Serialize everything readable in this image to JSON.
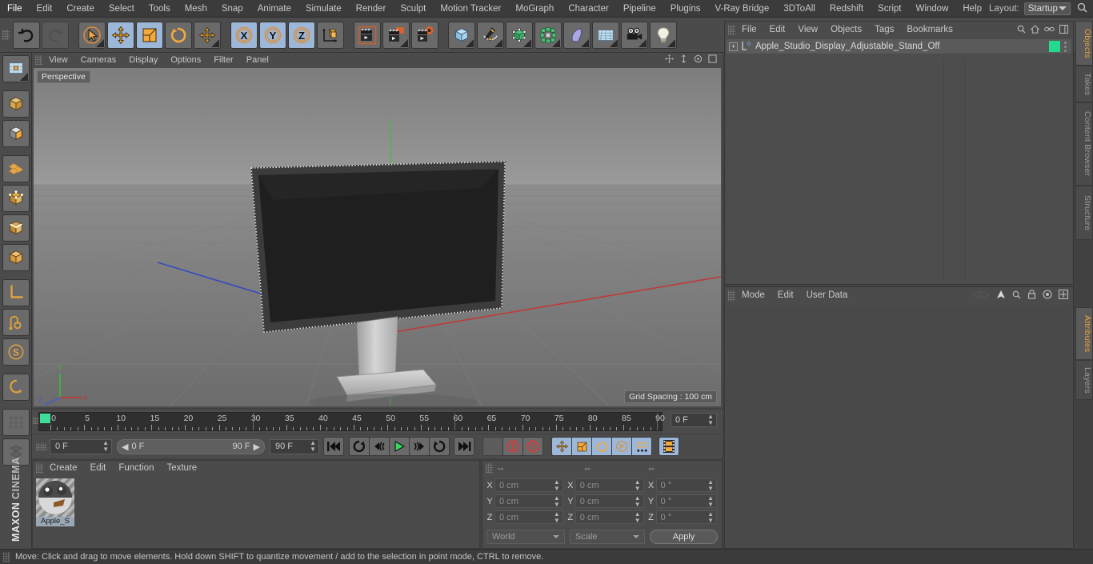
{
  "app": {
    "brand_maxon": "MAXON",
    "brand_product": "CINEMA 4D"
  },
  "menubar": {
    "items": [
      "File",
      "Edit",
      "Create",
      "Select",
      "Tools",
      "Mesh",
      "Snap",
      "Animate",
      "Simulate",
      "Render",
      "Sculpt",
      "Motion Tracker",
      "MoGraph",
      "Character",
      "Pipeline",
      "Plugins",
      "V-Ray Bridge",
      "3DToAll",
      "Redshift",
      "Script",
      "Window",
      "Help"
    ],
    "layout_label": "Layout:",
    "layout_value": "Startup",
    "search_icon": "magnifier-icon"
  },
  "toolbar": {
    "buttons": [
      {
        "name": "undo-button",
        "icon": "undo-arrow-icon",
        "state": "normal"
      },
      {
        "name": "redo-button",
        "icon": "redo-arrow-icon",
        "state": "disabled"
      },
      {
        "name": "select-tool-button",
        "icon": "cursor-circle-icon",
        "state": "normal"
      },
      {
        "name": "move-tool-button",
        "icon": "move-cross-icon",
        "state": "active"
      },
      {
        "name": "scale-tool-button",
        "icon": "scale-box-icon",
        "state": "normal"
      },
      {
        "name": "rotate-tool-button",
        "icon": "rotate-circle-icon",
        "state": "normal"
      },
      {
        "name": "axis-move-button",
        "icon": "move-cross-icon",
        "state": "normal"
      },
      {
        "name": "x-axis-button",
        "icon": "x-axis-icon",
        "state": "active"
      },
      {
        "name": "y-axis-button",
        "icon": "y-axis-icon",
        "state": "active"
      },
      {
        "name": "z-axis-button",
        "icon": "z-axis-icon",
        "state": "active"
      },
      {
        "name": "world-object-axis-button",
        "icon": "axis-cube-icon",
        "state": "normal"
      },
      {
        "name": "render-view-button",
        "icon": "clapper-icon",
        "state": "normal"
      },
      {
        "name": "render-picture-viewer-button",
        "icon": "clapper-picture-icon",
        "state": "normal"
      },
      {
        "name": "render-settings-button",
        "icon": "clapper-gear-icon",
        "state": "normal"
      },
      {
        "name": "cube-primitive-button",
        "icon": "cube-icon",
        "state": "normal"
      },
      {
        "name": "spline-pen-button",
        "icon": "pen-spline-icon",
        "state": "normal"
      },
      {
        "name": "nurbs-button",
        "icon": "subdivision-cube-icon",
        "state": "normal"
      },
      {
        "name": "array-button",
        "icon": "array-green-icon",
        "state": "normal"
      },
      {
        "name": "bend-deformer-button",
        "icon": "bend-deformer-icon",
        "state": "normal"
      },
      {
        "name": "floor-environment-button",
        "icon": "floor-grid-icon",
        "state": "normal"
      },
      {
        "name": "camera-button",
        "icon": "camera-icon",
        "state": "normal"
      },
      {
        "name": "light-button",
        "icon": "lightbulb-icon",
        "state": "normal"
      }
    ]
  },
  "leftbar": {
    "buttons": [
      {
        "name": "texture-axis-button",
        "icon": "texture-axis-icon"
      },
      {
        "name": "model-mode-button",
        "icon": "model-cube-icon"
      },
      {
        "name": "texture-mode-button",
        "icon": "texture-mode-icon"
      },
      {
        "name": "polygon-mode-button",
        "icon": "polygon-mesh-icon"
      },
      {
        "name": "point-mode-button",
        "icon": "point-mode-icon"
      },
      {
        "name": "edge-mode-button",
        "icon": "edge-mode-icon"
      },
      {
        "name": "polygon-select-button",
        "icon": "polygon-orange-icon"
      },
      {
        "name": "workplane-button",
        "icon": "workplane-icon"
      },
      {
        "name": "enable-axis-button",
        "icon": "axis-modify-icon"
      },
      {
        "name": "soft-selection-button",
        "icon": "soft-selection-icon"
      },
      {
        "name": "snap-toggle-button",
        "icon": "snap-magnet-icon"
      },
      {
        "name": "viewport-solo-button",
        "icon": "solo-icon"
      },
      {
        "name": "layout-grid-button",
        "icon": "grid-dots-icon"
      }
    ]
  },
  "viewport": {
    "menu": [
      "View",
      "Cameras",
      "Display",
      "Options",
      "Filter",
      "Panel"
    ],
    "perspective_label": "Perspective",
    "grid_spacing_label": "Grid Spacing : 100 cm",
    "icons": [
      "pan-icon",
      "zoom-icon",
      "rotate-icon",
      "maximize-icon"
    ]
  },
  "object_manager": {
    "menu": [
      "File",
      "Edit",
      "View",
      "Objects",
      "Tags",
      "Bookmarks"
    ],
    "icons": [
      "search-icon",
      "home-icon",
      "link-icon",
      "layout-icon"
    ],
    "rows": [
      {
        "name": "Apple_Studio_Display_Adjustable_Stand_Off",
        "expand": "+",
        "level_badge": "0",
        "swatch_color": "#22d98e"
      }
    ]
  },
  "attribute_manager": {
    "menu": [
      "Mode",
      "Edit",
      "User Data"
    ],
    "icons": [
      "history-icon",
      "arrow-up-icon",
      "search-icon",
      "lock-icon",
      "target-icon",
      "layout-icon"
    ]
  },
  "right_tabs": [
    {
      "label": "Objects",
      "selected": true
    },
    {
      "label": "Takes",
      "selected": false
    },
    {
      "label": "Content Browser",
      "selected": false
    },
    {
      "label": "Structure",
      "selected": false
    },
    {
      "label": "Attributes",
      "selected": true
    },
    {
      "label": "Layers",
      "selected": false
    }
  ],
  "timeline": {
    "ticks": [
      0,
      5,
      10,
      15,
      20,
      25,
      30,
      35,
      40,
      45,
      50,
      55,
      60,
      65,
      70,
      75,
      80,
      85,
      90
    ],
    "min_frame": 0,
    "max_frame": 90,
    "current_frame_field": "0 F"
  },
  "transport": {
    "current_frame": "0 F",
    "range_start": "0 F",
    "range_end": "90 F",
    "end_frame": "90 F",
    "buttons": [
      {
        "name": "go-to-start-button",
        "icon": "skip-start-icon",
        "state": "normal"
      },
      {
        "name": "loop-back-button",
        "icon": "loop-back-icon",
        "state": "normal"
      },
      {
        "name": "step-back-button",
        "icon": "step-back-icon",
        "state": "normal"
      },
      {
        "name": "play-button",
        "icon": "play-icon",
        "state": "normal"
      },
      {
        "name": "step-forward-button",
        "icon": "step-forward-icon",
        "state": "normal"
      },
      {
        "name": "loop-forward-button",
        "icon": "loop-forward-icon",
        "state": "normal"
      },
      {
        "name": "go-to-end-button",
        "icon": "skip-end-icon",
        "state": "normal"
      },
      {
        "name": "record-active-objects-button",
        "icon": "key-icon",
        "state": "disabled"
      },
      {
        "name": "autokeying-button",
        "icon": "record-circle-icon",
        "state": "red"
      },
      {
        "name": "keyframe-help-button",
        "icon": "question-circle-icon",
        "state": "red"
      },
      {
        "name": "position-key-button",
        "icon": "move-cross-icon",
        "state": "active"
      },
      {
        "name": "scale-key-button",
        "icon": "scale-box-icon",
        "state": "active"
      },
      {
        "name": "rotation-key-button",
        "icon": "rotate-circle-icon",
        "state": "active"
      },
      {
        "name": "param-key-button",
        "icon": "p-circle-icon",
        "state": "active"
      },
      {
        "name": "pla-key-button",
        "icon": "dots-grid-icon",
        "state": "active"
      },
      {
        "name": "timeline-button",
        "icon": "film-strip-icon",
        "state": "active"
      }
    ]
  },
  "material_manager": {
    "menu": [
      "Create",
      "Edit",
      "Function",
      "Texture"
    ],
    "materials": [
      {
        "name": "Apple_S"
      }
    ]
  },
  "coordinates": {
    "headers": [
      "--",
      "--",
      "--"
    ],
    "rows": [
      {
        "axis": "X",
        "position": "0 cm",
        "size": "0 cm",
        "rotation": "0 °"
      },
      {
        "axis": "Y",
        "position": "0 cm",
        "size": "0 cm",
        "rotation": "0 °"
      },
      {
        "axis": "Z",
        "position": "0 cm",
        "size": "0 cm",
        "rotation": "0 °"
      }
    ],
    "coord_system": "World",
    "size_mode": "Scale",
    "apply_label": "Apply"
  },
  "statusbar": {
    "message": "Move: Click and drag to move elements. Hold down SHIFT to quantize movement / add to the selection in point mode, CTRL to remove."
  }
}
